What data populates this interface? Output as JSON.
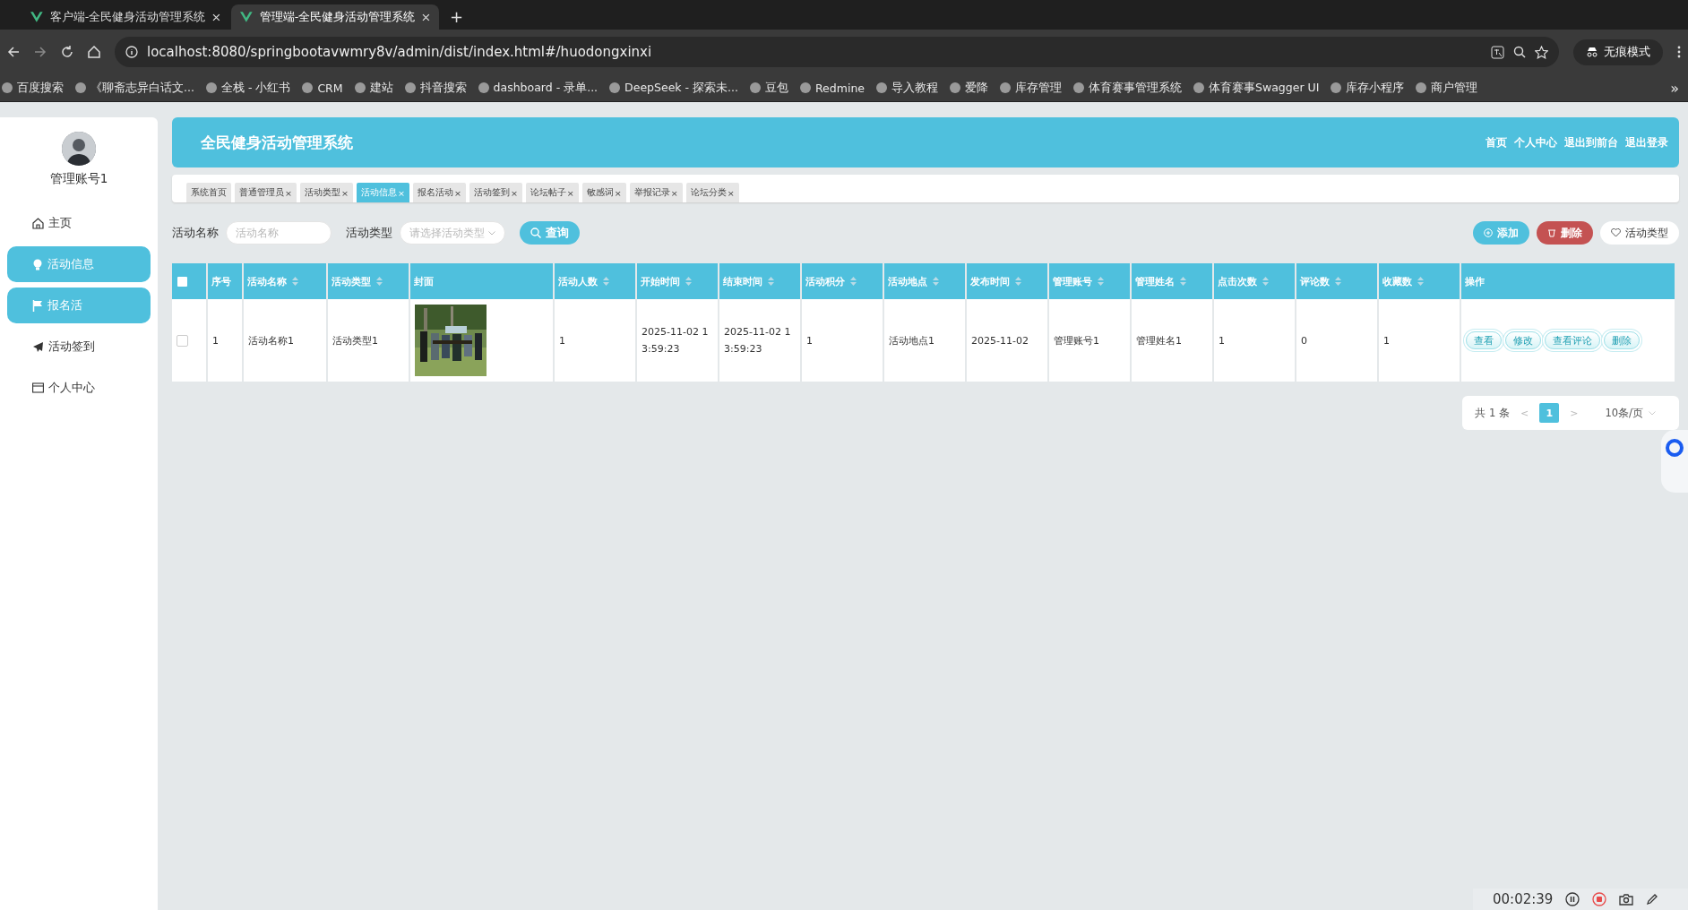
{
  "browser": {
    "tabs": [
      {
        "title": "客户端-全民健身活动管理系统",
        "selected": false
      },
      {
        "title": "管理端-全民健身活动管理系统",
        "selected": true
      }
    ],
    "new_tab": "+",
    "address": "localhost:8080/springbootavwmry8v/admin/dist/index.html#/huodongxinxi",
    "incognito": "无痕模式",
    "bookmarks": [
      "百度搜索",
      "《聊斋志异白话文...",
      "全栈 - 小红书",
      "CRM",
      "建站",
      "抖音搜索",
      "dashboard - 录单...",
      "DeepSeek - 探索未...",
      "豆包",
      "Redmine",
      "导入教程",
      "爱降",
      "库存管理",
      "体育赛事管理系统",
      "体育赛事Swagger UI",
      "库存小程序",
      "商户管理"
    ],
    "more": "»"
  },
  "sidebar": {
    "user": "管理账号1",
    "items": [
      {
        "label": "主页",
        "highlighted": false
      },
      {
        "label": "活动信息",
        "highlighted": true
      },
      {
        "label": "报名活",
        "highlighted": true
      },
      {
        "label": "活动签到",
        "highlighted": false
      },
      {
        "label": "个人中心",
        "highlighted": false
      }
    ]
  },
  "header": {
    "title": "全民健身活动管理系统",
    "links": [
      "首页",
      "个人中心",
      "退出到前台",
      "退出登录"
    ]
  },
  "tags": [
    {
      "label": "系统首页",
      "closable": false,
      "selected": false
    },
    {
      "label": "普通管理员",
      "closable": true,
      "selected": false
    },
    {
      "label": "活动类型",
      "closable": true,
      "selected": false
    },
    {
      "label": "活动信息",
      "closable": true,
      "selected": true
    },
    {
      "label": "报名活动",
      "closable": true,
      "selected": false
    },
    {
      "label": "活动签到",
      "closable": true,
      "selected": false
    },
    {
      "label": "论坛帖子",
      "closable": true,
      "selected": false
    },
    {
      "label": "敏感词",
      "closable": true,
      "selected": false
    },
    {
      "label": "举报记录",
      "closable": true,
      "selected": false
    },
    {
      "label": "论坛分类",
      "closable": true,
      "selected": false
    }
  ],
  "close_mark": "×",
  "search": {
    "fields": [
      {
        "label": "活动名称",
        "placeholder": "活动名称",
        "kind": "text"
      },
      {
        "label": "活动类型",
        "placeholder": "请选择活动类型",
        "kind": "select"
      }
    ],
    "button": "查询"
  },
  "actions": [
    {
      "label": "添加",
      "kind": "primary"
    },
    {
      "label": "删除",
      "kind": "danger"
    },
    {
      "label": "活动类型",
      "kind": "plain"
    }
  ],
  "table": {
    "select_all": {
      "checked": false
    },
    "columns": [
      {
        "kind": "text",
        "label": "序号",
        "sortable": false
      },
      {
        "kind": "text",
        "label": "活动名称",
        "sortable": true
      },
      {
        "kind": "text",
        "label": "活动类型",
        "sortable": true
      },
      {
        "label": "封面",
        "sortable": false
      },
      {
        "kind": "text",
        "label": "活动人数",
        "sortable": true
      },
      {
        "kind": "text",
        "label": "开始时间",
        "sortable": true
      },
      {
        "kind": "text",
        "label": "结束时间",
        "sortable": true
      },
      {
        "kind": "text",
        "label": "活动积分",
        "sortable": true
      },
      {
        "kind": "text",
        "label": "活动地点",
        "sortable": true
      },
      {
        "kind": "text",
        "label": "发布时间",
        "sortable": true
      },
      {
        "kind": "text",
        "label": "管理账号",
        "sortable": true
      },
      {
        "kind": "text",
        "label": "管理姓名",
        "sortable": true
      },
      {
        "kind": "text",
        "label": "点击次数",
        "sortable": true
      },
      {
        "kind": "text",
        "label": "评论数",
        "sortable": true
      },
      {
        "kind": "text",
        "label": "收藏数",
        "sortable": true
      },
      {
        "kind": "actions",
        "label": "操作",
        "sortable": false
      }
    ],
    "rows": [
      {
        "checked": false,
        "cells": [
          "1",
          "活动名称1",
          "活动类型1",
          {
            "kind": "picture"
          },
          "1",
          "2025-11-02 13:59:23",
          "2025-11-02 13:59:23",
          "1",
          "活动地点1",
          "2025-11-02",
          "管理账号1",
          "管理姓名1",
          "1",
          "0",
          "1",
          [
            "查看",
            "修改",
            "查看评论",
            "删除"
          ]
        ]
      }
    ]
  },
  "pagination": {
    "total": "共 1 条",
    "prev": "<",
    "pages": [
      {
        "label": "1",
        "selected": true
      }
    ],
    "next": ">",
    "page_size": "10条/页"
  },
  "recorder": {
    "time": "00:02:39"
  }
}
